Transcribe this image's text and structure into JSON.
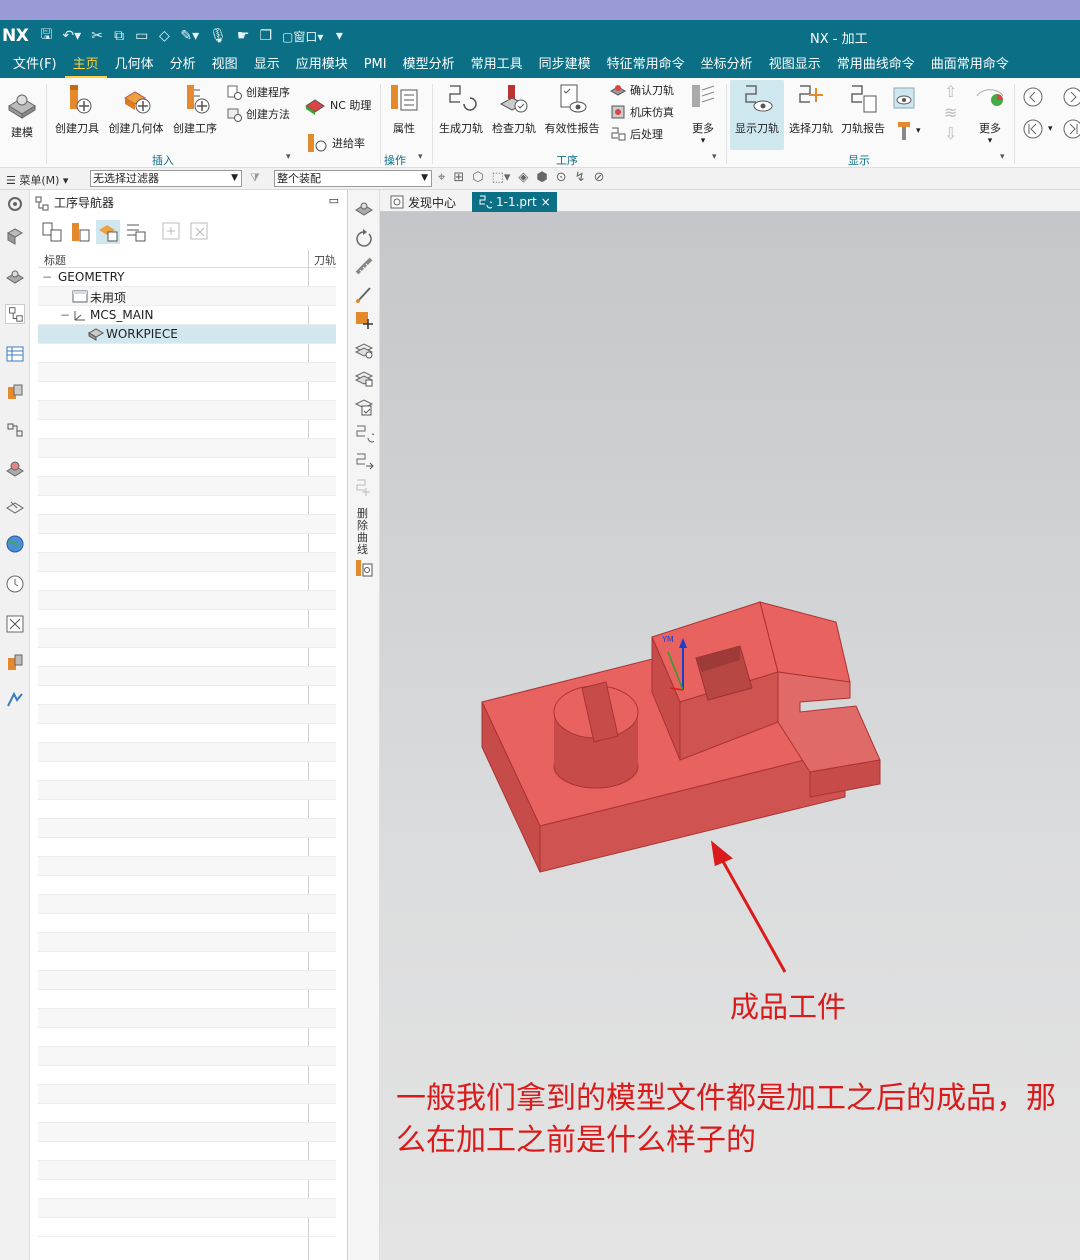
{
  "app": {
    "logo": "NX",
    "window_title": "NX - 加工",
    "window_menu": "窗口"
  },
  "menu": [
    "文件(F)",
    "主页",
    "几何体",
    "分析",
    "视图",
    "显示",
    "应用模块",
    "PMI",
    "模型分析",
    "常用工具",
    "同步建模",
    "特征常用命令",
    "坐标分析",
    "视图显示",
    "常用曲线命令",
    "曲面常用命令"
  ],
  "active_menu_index": 1,
  "ribbon": {
    "modeling": "建模",
    "create_tool": "创建刀具",
    "create_geometry": "创建几何体",
    "create_operation": "创建工序",
    "create_program": "创建程序",
    "create_method": "创建方法",
    "nc_assistant": "NC 助理",
    "feed_rate": "进给率",
    "properties": "属性",
    "generate_toolpath": "生成刀轨",
    "check_toolpath": "检查刀轨",
    "validity_report": "有效性报告",
    "verify_toolpath": "确认刀轨",
    "machine_sim": "机床仿真",
    "post_process": "后处理",
    "more1": "更多",
    "show_toolpath": "显示刀轨",
    "select_toolpath": "选择刀轨",
    "toolpath_report": "刀轨报告",
    "more2": "更多",
    "group_insert": "插入",
    "group_operation": "操作",
    "group_process": "工序",
    "group_display": "显示"
  },
  "filterbar": {
    "menu_label": "菜单(M)",
    "filter_value": "无选择过滤器",
    "assembly_value": "整个装配"
  },
  "navigator": {
    "title": "工序导航器",
    "col_title": "标题",
    "col_path": "刀轨",
    "rows": [
      "GEOMETRY",
      "未用项",
      "MCS_MAIN",
      "WORKPIECE"
    ]
  },
  "vertical_toolbar": {
    "remove_label": "删除曲线"
  },
  "tabs": [
    "发现中心",
    "1-1.prt"
  ],
  "model": {
    "face_color": "#e8625f",
    "side_color": "#c74b48",
    "axis_y": "YM",
    "axis_z": "ZM"
  },
  "annotations": {
    "arrow_label": "成品工件",
    "description": "一般我们拿到的模型文件都是加工之后的成品，那么在加工之前是什么样子的"
  }
}
